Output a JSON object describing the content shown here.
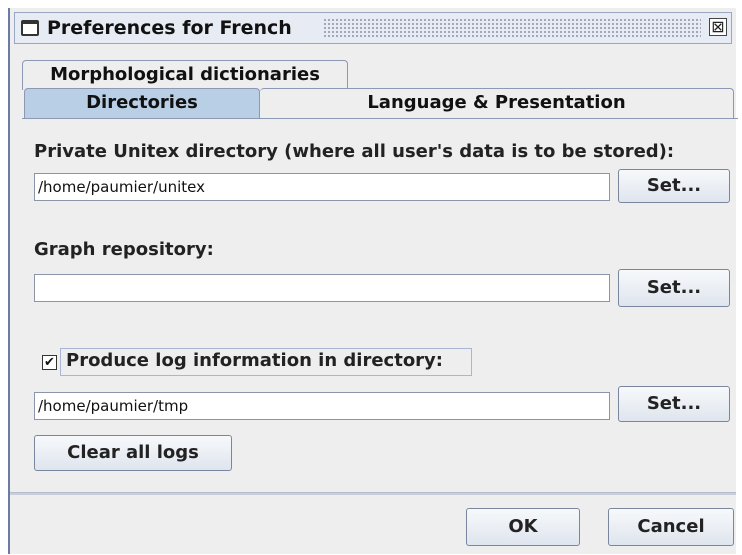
{
  "window": {
    "title": "Preferences for French",
    "close_glyph": "⊠",
    "icon": "window-icon"
  },
  "tabs": {
    "morphological_dictionaries": "Morphological dictionaries",
    "directories": "Directories",
    "language_presentation": "Language & Presentation",
    "selected": "Directories"
  },
  "directories": {
    "private_label": "Private Unitex directory (where all user's data is to be stored):",
    "private_value": "/home/paumier/unitex",
    "graph_label": "Graph repository:",
    "graph_value": "",
    "log_checkbox_label": "Produce log information in directory:",
    "log_checked": true,
    "log_check_glyph": "✔",
    "log_value": "/home/paumier/tmp",
    "set_label": "Set...",
    "clear_logs_label": "Clear all logs"
  },
  "footer": {
    "ok_label": "OK",
    "cancel_label": "Cancel"
  },
  "colors": {
    "selected_tab": "#b8cfe5",
    "window_background": "#eeeeee",
    "title_bar": "#e7ebf3"
  }
}
